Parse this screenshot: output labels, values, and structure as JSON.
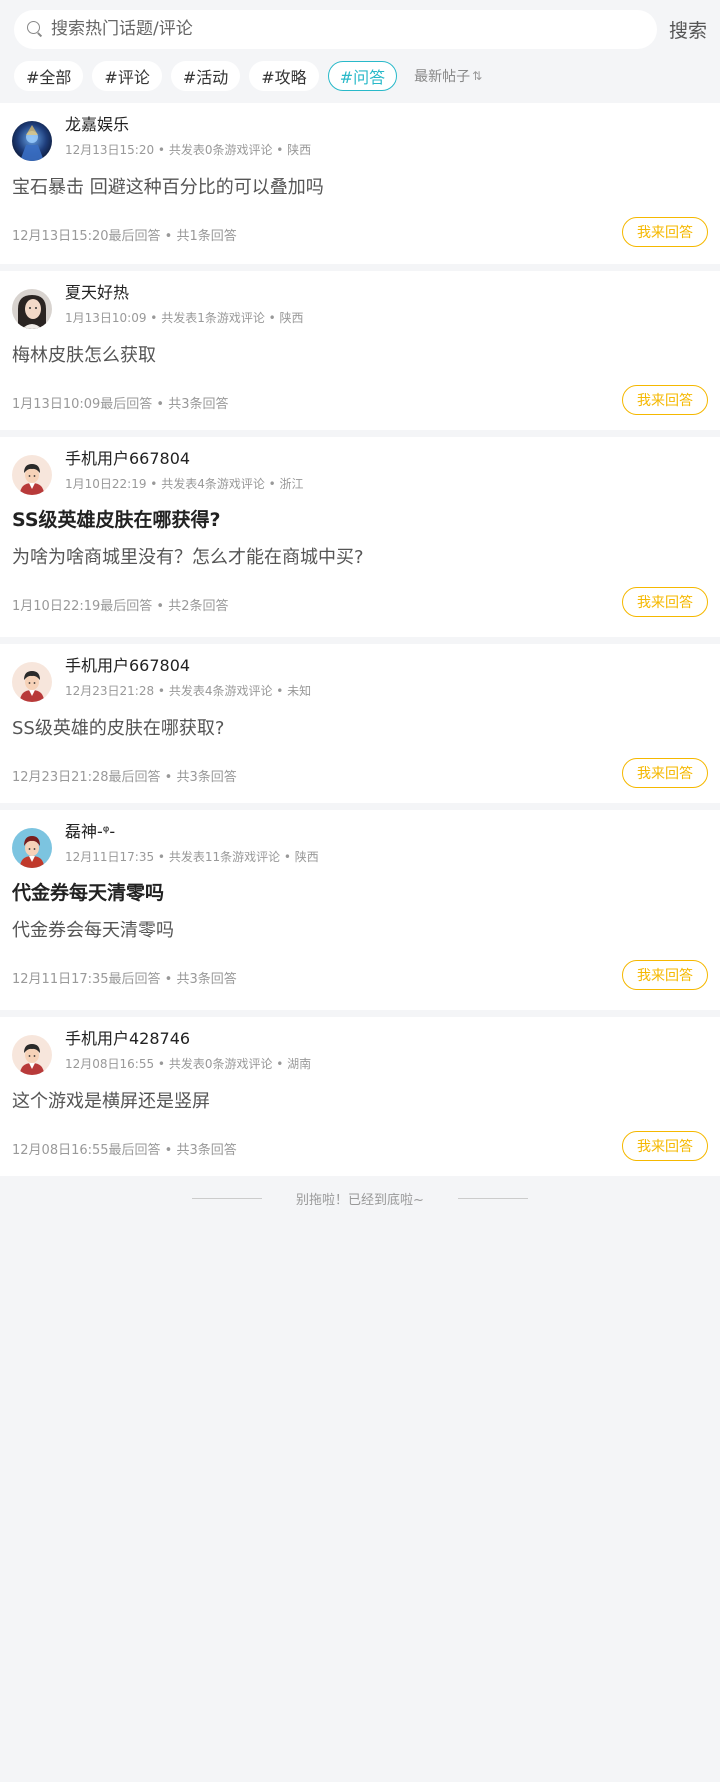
{
  "search": {
    "placeholder": "搜索热门话题/评论",
    "button": "搜索"
  },
  "tags": [
    {
      "label": "#全部",
      "active": false
    },
    {
      "label": "#评论",
      "active": false
    },
    {
      "label": "#活动",
      "active": false
    },
    {
      "label": "#攻略",
      "active": false
    },
    {
      "label": "#问答",
      "active": true
    }
  ],
  "sort": {
    "label": "最新帖子",
    "icon": "sort-arrows-icon"
  },
  "colors": {
    "accent_teal": "#29b9c9",
    "answer_orange": "#f5b800",
    "background": "#f4f5f7"
  },
  "posts": [
    {
      "username": "龙嘉娱乐",
      "meta": "12月13日15:20 • 共发表0条游戏评论 • 陕西",
      "title": "",
      "body": "宝石暴击 回避这种百分比的可以叠加吗",
      "footer": "12月13日15:20最后回答 • 共1条回答",
      "answer_label": "我来回答",
      "avatar": "dark-blue-avatar"
    },
    {
      "username": "夏天好热",
      "meta": "1月13日10:09 • 共发表1条游戏评论 • 陕西",
      "title": "",
      "body": "梅林皮肤怎么获取",
      "footer": "1月13日10:09最后回答 • 共3条回答",
      "answer_label": "我来回答",
      "avatar": "photo-avatar"
    },
    {
      "username": "手机用户667804",
      "meta": "1月10日22:19 • 共发表4条游戏评论 • 浙江",
      "title": "SS级英雄皮肤在哪获得?",
      "body": "为啥为啥商城里没有？怎么才能在商城中买?",
      "footer": "1月10日22:19最后回答 • 共2条回答",
      "answer_label": "我来回答",
      "avatar": "cartoon-boy-avatar"
    },
    {
      "username": "手机用户667804",
      "meta": "12月23日21:28 • 共发表4条游戏评论 • 未知",
      "title": "",
      "body": "SS级英雄的皮肤在哪获取?",
      "footer": "12月23日21:28最后回答 • 共3条回答",
      "answer_label": "我来回答",
      "avatar": "cartoon-boy-avatar"
    },
    {
      "username": "磊神-ᵠ-",
      "meta": "12月11日17:35 • 共发表11条游戏评论 • 陕西",
      "title": "代金券每天清零吗",
      "body": "代金券会每天清零吗",
      "footer": "12月11日17:35最后回答 • 共3条回答",
      "answer_label": "我来回答",
      "avatar": "cartoon-boy-blue-avatar"
    },
    {
      "username": "手机用户428746",
      "meta": "12月08日16:55 • 共发表0条游戏评论 • 湖南",
      "title": "",
      "body": "这个游戏是横屏还是竖屏",
      "footer": "12月08日16:55最后回答 • 共3条回答",
      "answer_label": "我来回答",
      "avatar": "cartoon-boy-avatar"
    }
  ],
  "end_text": "别拖啦！已经到底啦~"
}
